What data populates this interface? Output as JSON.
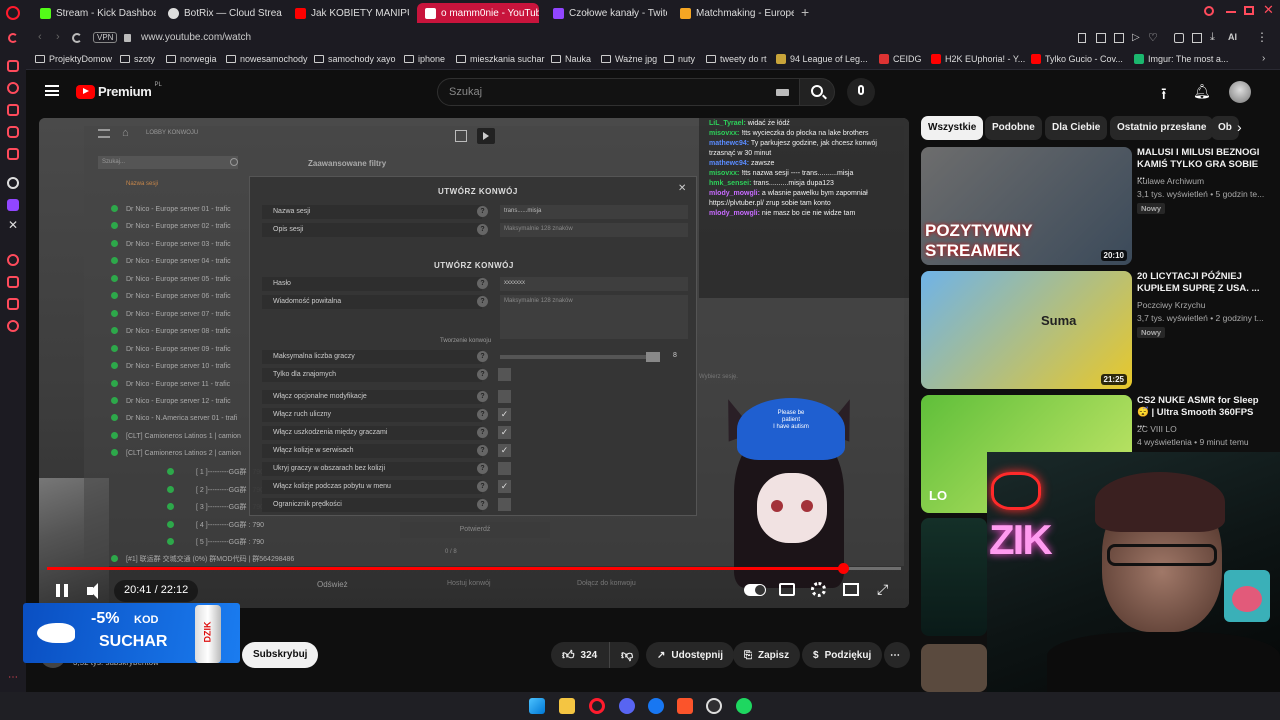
{
  "browser": {
    "tabs": [
      {
        "label": "Stream - Kick Dashboard",
        "color": "#53fc18"
      },
      {
        "label": "BotRix — Cloud Streaming",
        "color": "#dddddd"
      },
      {
        "label": "Jak KOBIETY MANIPULU...",
        "color": "#ff0000"
      },
      {
        "label": "o mamm0nie - YouTube",
        "color": "#ffffff",
        "active": true
      },
      {
        "label": "Czołowe kanały - Twitch",
        "color": "#9146ff"
      },
      {
        "label": "Matchmaking - Europe 5v5",
        "color": "#f5a623"
      }
    ],
    "vpn": "VPN",
    "url": "www.youtube.com/watch",
    "bookmarks": [
      {
        "label": "ProjektyDomow",
        "icon": "folder-icon"
      },
      {
        "label": "szoty",
        "icon": "folder-icon"
      },
      {
        "label": "norwegia",
        "icon": "folder-icon"
      },
      {
        "label": "nowesamochody",
        "icon": "folder-icon"
      },
      {
        "label": "samochody xayo",
        "icon": "folder-icon"
      },
      {
        "label": "iphone",
        "icon": "folder-icon"
      },
      {
        "label": "mieszkania suchar",
        "icon": "folder-icon"
      },
      {
        "label": "Nauka",
        "icon": "folder-icon"
      },
      {
        "label": "Ważne jpg",
        "icon": "folder-icon"
      },
      {
        "label": "nuty",
        "icon": "folder-icon"
      },
      {
        "label": "tweety do rt",
        "icon": "folder-icon"
      },
      {
        "label": "94 League of Leg...",
        "icon": "lol-icon"
      },
      {
        "label": "CEIDG",
        "icon": "ceidg-icon"
      },
      {
        "label": "H2K EUphoria! - Y...",
        "icon": "youtube-icon"
      },
      {
        "label": "Tylko Gucio - Cov...",
        "icon": "youtube-icon"
      },
      {
        "label": "Imgur: The most a...",
        "icon": "imgur-icon"
      }
    ]
  },
  "youtube": {
    "logo": "Premium",
    "logo_region": "PL",
    "search_placeholder": "Szukaj",
    "player": {
      "time_current": "20:41",
      "time_total": "22:12",
      "time_separator": "/",
      "progress": 0.932
    },
    "game": {
      "breadcrumb": "LOBBY KONWOJU",
      "search": "Szukaj...",
      "advanced_filters": "Zaawansowane filtry",
      "list_header": "Nazwa sesji",
      "servers": [
        "Dr Nico - Europe server 01 - trafic",
        "Dr Nico - Europe server 02 - trafic",
        "Dr Nico - Europe server 03 - trafic",
        "Dr Nico - Europe server 04 - trafic",
        "Dr Nico - Europe server 05 - trafic",
        "Dr Nico - Europe server 06 - trafic",
        "Dr Nico - Europe server 07 - trafic",
        "Dr Nico - Europe server 08 - trafic",
        "Dr Nico - Europe server 09 - trafic",
        "Dr Nico - Europe server 10 - trafic",
        "Dr Nico - Europe server 11 - trafic",
        "Dr Nico - Europe server 12 - trafic",
        "Dr Nico - N.America server 01 - trafi",
        "[CLT] Camioneros Latinos 1 | camion",
        "[CLT] Camioneros Latinos 2 | camion",
        "[ 1 ]---------GG群 : 790",
        "[ 2 ]---------GG群 : 790",
        "[ 3 ]---------GG群 : 790",
        "[ 4 ]---------GG群 : 790",
        "[ 5 ]---------GG群 : 790",
        "[#1] 联运群 交城交通 (0%) 群MOD代码 | 群564298486"
      ],
      "dialog_title": "UTWÓRZ KONWÓJ",
      "dialog_subtitle": "UTWÓRZ KONWÓJ",
      "section_label": "Tworzenie konwoju",
      "fields": [
        {
          "label": "Nazwa sesji",
          "value": "trans......misja"
        },
        {
          "label": "Opis sesji",
          "value": "Maksymalnie 128 znaków"
        },
        {
          "label": "Hasło",
          "value": "xxxxxxx"
        },
        {
          "label": "Wiadomość powitalna",
          "value": "Maksymalnie 128 znaków"
        }
      ],
      "slider": {
        "label": "Maksymalna liczba graczy",
        "value": "8"
      },
      "options": [
        {
          "label": "Tylko dla znajomych",
          "checked": false
        },
        {
          "label": "Włącz opcjonalne modyfikacje",
          "checked": false
        },
        {
          "label": "Włącz ruch uliczny",
          "checked": true
        },
        {
          "label": "Włącz uszkodzenia między graczami",
          "checked": true
        },
        {
          "label": "Włącz kolizje w serwisach",
          "checked": true
        },
        {
          "label": "Ukryj graczy w obszarach bez kolizji",
          "checked": false
        },
        {
          "label": "Włącz kolizje podczas pobytu w menu",
          "checked": true
        },
        {
          "label": "Ogranicznik prędkości",
          "checked": false
        }
      ],
      "confirm": "Potwierdź",
      "players_count": "0 / 8",
      "hint": "Wybierz sesję.",
      "footer_buttons": [
        "Odśwież",
        "Hostuj konwój",
        "Dołącz do konwoju"
      ]
    },
    "chat": [
      {
        "user": "LiL_Tyrael:",
        "text": "widać że łódź",
        "color": "#2dd25a"
      },
      {
        "user": "misovxx:",
        "text": "!tts wycieczka do płocka na lake brothers",
        "color": "#2dd25a"
      },
      {
        "user": "mathewc94:",
        "text": "Ty parkujesz godzine, jak chcesz konwój trzasnąć w 30 minut",
        "color": "#5a8cff"
      },
      {
        "user": "mathewc94:",
        "text": "zawsze",
        "color": "#5a8cff"
      },
      {
        "user": "misovxx:",
        "text": "!tts nazwa sesji ---- trans..........misja",
        "color": "#2dd25a"
      },
      {
        "user": "hmk_sensei:",
        "text": "trans..........misja dupa123",
        "color": "#2dd25a"
      },
      {
        "user": "mlody_mowgli:",
        "text": "a wlasnie pawelku bym zapomniał https://plvtuber.pl/ zrup sobie tam konto",
        "color": "#c86bff"
      },
      {
        "user": "mlody_mowgli:",
        "text": "nie masz bo cie nie widze tam",
        "color": "#c86bff"
      }
    ],
    "vtuber_cap": [
      "Please be",
      "patient",
      "I have autism"
    ],
    "subscribers": "3,52 tys. subskrybentów",
    "subscribe": "Subskrybuj",
    "likes": "324",
    "share": "Udostępnij",
    "save": "Zapisz",
    "thanks": "Podziękuj",
    "chips": [
      "Wszystkie",
      "Podobne",
      "Dla Ciebie",
      "Ostatnio przesłane",
      "Ob"
    ],
    "recommended": [
      {
        "title": "MALUSI I MILUSI BEZNOGI KAMIŚ TYLKO GRA SOBIE ...",
        "channel": "Kulawe Archiwum",
        "meta": "3,1 tys. wyświetleń • 5 godzin te...",
        "badge": "Nowy",
        "duration": "20:10",
        "thumb_text": "POZYTYWNY STREAMEK"
      },
      {
        "title": "20 LICYTACJI PÓŹNIEJ KUPIŁEM SUPRĘ Z USA. ...",
        "channel": "Poczciwy Krzychu",
        "meta": "3,7 tys. wyświetleń • 2 godziny t...",
        "badge": "Nowy",
        "duration": "21:25",
        "thumb_text": "Suma"
      },
      {
        "title": "CS2 NUKE ASMR for Sleep 😴 | Ultra Smooth 360FPS ...",
        "channel": "2C VIII LO",
        "meta": "4 wyświetlenia • 9 minut temu",
        "badge": "",
        "duration": "",
        "thumb_text": "LO"
      }
    ]
  },
  "promo": {
    "discount": "-5%",
    "kod": "KOD",
    "code": "SUCHAR",
    "brand": "DZIK"
  },
  "webcam": {
    "logo": "ZIK"
  }
}
